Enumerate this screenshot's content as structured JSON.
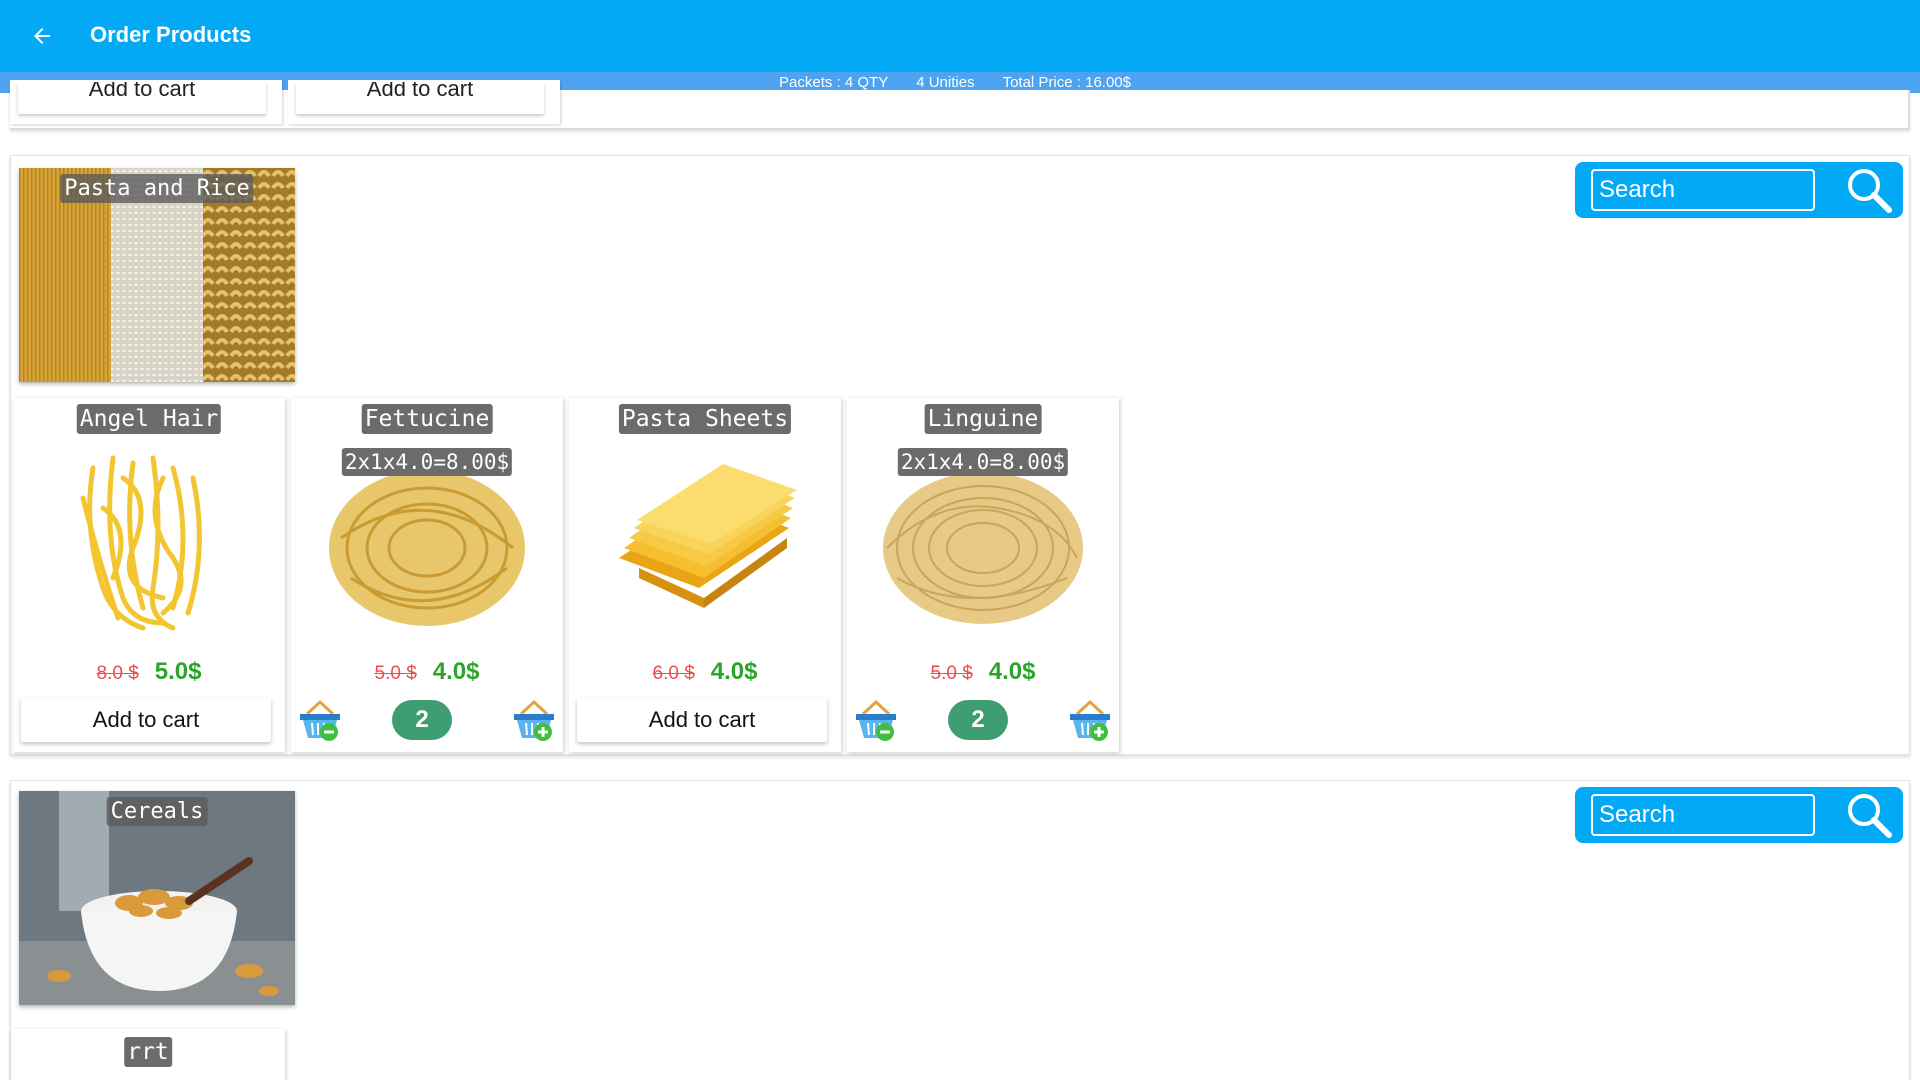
{
  "appbar": {
    "title": "Order Products",
    "back_icon": "arrow-left-icon"
  },
  "summary": {
    "packets": "Packets : 4 QTY",
    "unities": "4 Unities",
    "total": "Total Price : 16.00$"
  },
  "previous_section": {
    "buttons": [
      "Add to cart",
      "Add to cart"
    ]
  },
  "sections": [
    {
      "category": "Pasta and Rice",
      "search_placeholder": "Search",
      "products": [
        {
          "name": "Angel Hair",
          "old_price": "8.0 $",
          "new_price": "5.0$",
          "action": "Add to cart"
        },
        {
          "name": "Fettucine",
          "calc": "2x1x4.0=8.00$",
          "old_price": "5.0 $",
          "new_price": "4.0$",
          "qty": "2"
        },
        {
          "name": "Pasta Sheets",
          "old_price": "6.0 $",
          "new_price": "4.0$",
          "action": "Add to cart"
        },
        {
          "name": "Linguine",
          "calc": "2x1x4.0=8.00$",
          "old_price": "5.0 $",
          "new_price": "4.0$",
          "qty": "2"
        }
      ]
    },
    {
      "category": "Cereals",
      "search_placeholder": "Search",
      "products": [
        {
          "name": "rrt"
        }
      ]
    }
  ],
  "colors": {
    "primary": "#03a9f4",
    "summary_bar": "#4ea3f0",
    "old_price": "#f04a4a",
    "new_price": "#2aa52a",
    "qty_badge": "#3e9e71"
  }
}
